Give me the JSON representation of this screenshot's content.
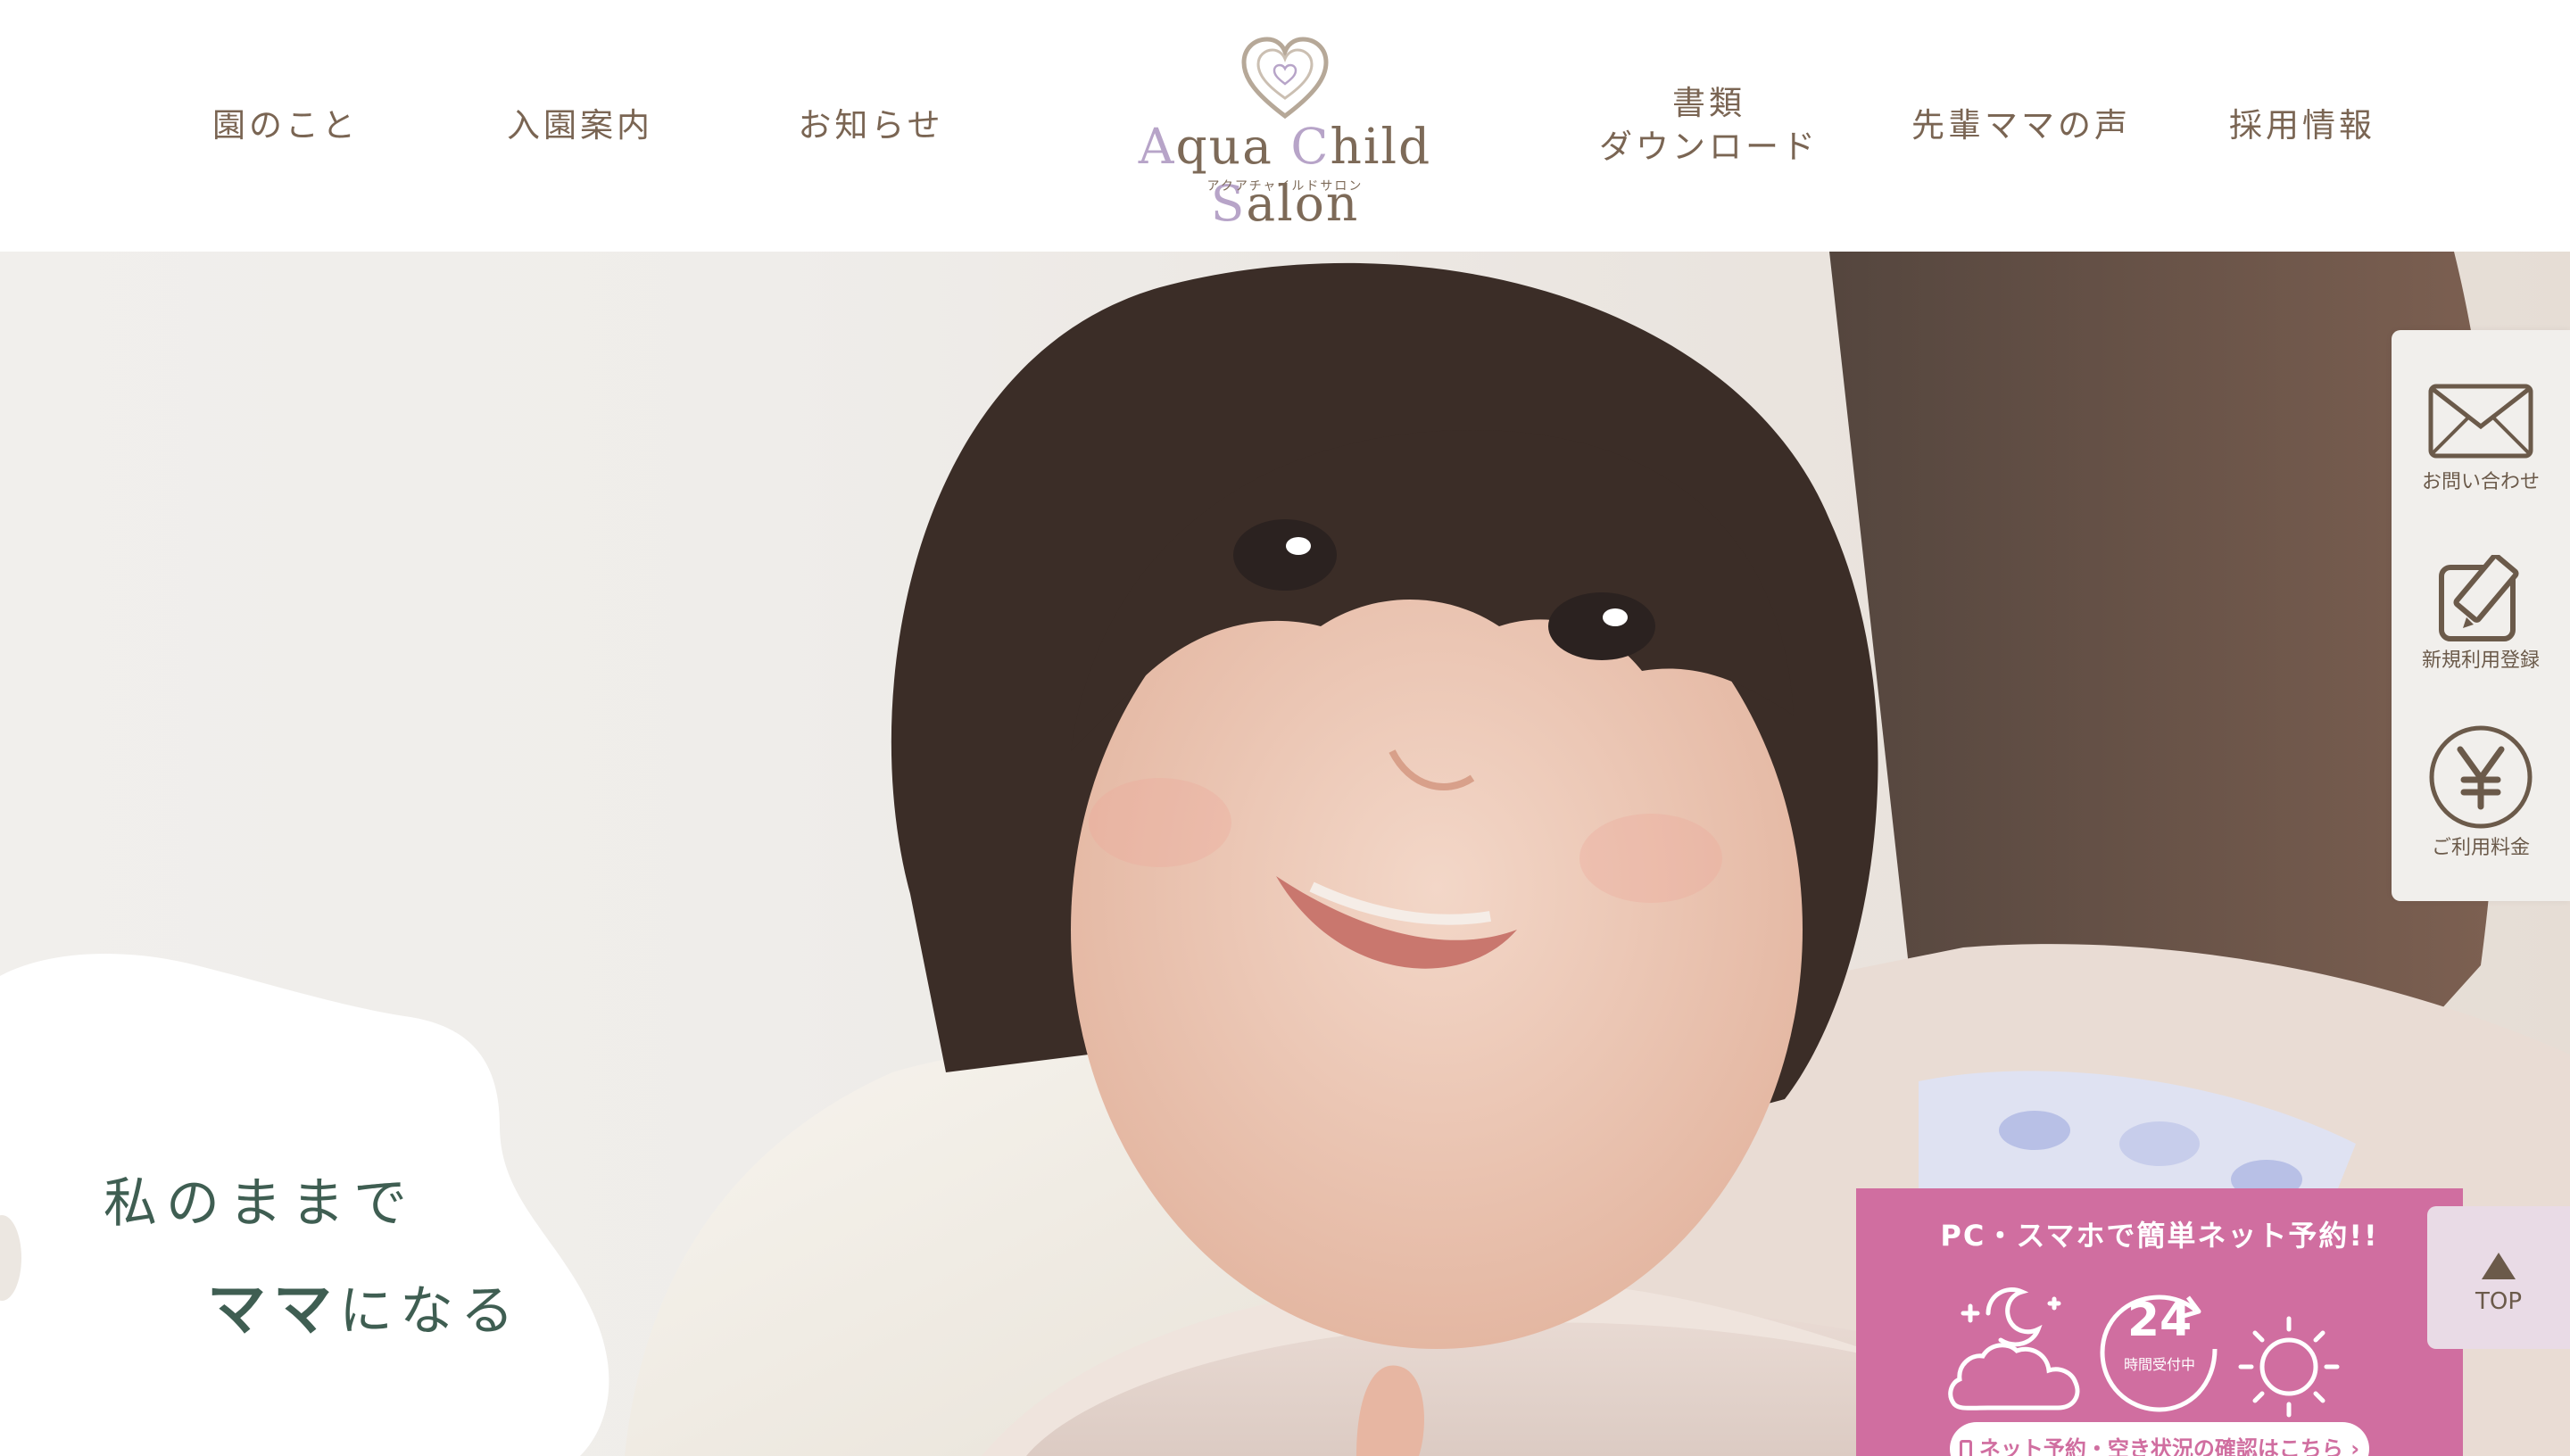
{
  "header": {
    "nav_left": [
      {
        "label": "園のこと"
      },
      {
        "label": "入園案内"
      },
      {
        "label": "お知らせ"
      }
    ],
    "logo": {
      "title_a": "A",
      "title_qua": "qua ",
      "title_c": "C",
      "title_hild": "hild ",
      "title_s": "S",
      "title_alon": "alon",
      "subtitle": "アクアチャイルドサロン"
    },
    "nav_right": [
      {
        "line1": "書類",
        "line2": "ダウンロード"
      },
      {
        "label": "先輩ママの声"
      },
      {
        "label": "採用情報"
      }
    ]
  },
  "hero": {
    "tagline_line1": "私のままで",
    "tagline_strong": "ママ",
    "tagline_rest": "になる"
  },
  "side_menu": {
    "contact": {
      "label": "お問い合わせ",
      "icon": "envelope-icon"
    },
    "register": {
      "label": "新規利用登録",
      "icon": "edit-icon"
    },
    "fee": {
      "label": "ご利用料金",
      "icon": "yen-icon"
    }
  },
  "top_button": {
    "label": "TOP"
  },
  "reservation": {
    "title": "PC・スマホで簡単ネット予約!!",
    "badge_number": "24",
    "badge_text": "時間受付中",
    "button_label": "ネット予約・空き状況の確認はこちら ›"
  },
  "colors": {
    "accent_pink": "#d06ea0",
    "text_brown": "#6b5a4a",
    "tagline_green": "#3f5e52",
    "logo_lavender": "#b7a4c8"
  }
}
